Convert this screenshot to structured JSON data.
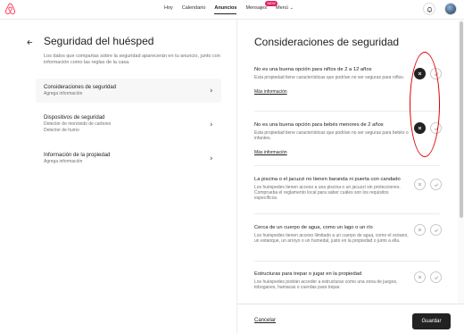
{
  "nav": {
    "links": [
      "Hoy",
      "Calendario",
      "Anuncios",
      "Mensajes",
      "Menú"
    ],
    "active": "Anuncios",
    "messages_badge": "NEW"
  },
  "left": {
    "title": "Seguridad del huésped",
    "description": "Los datos que compartas sobre la seguridad aparecerán en tu anuncio, junto con información como las reglas de la casa.",
    "items": [
      {
        "title": "Consideraciones de seguridad",
        "sub": [
          "Agrega información"
        ],
        "selected": true
      },
      {
        "title": "Dispositivos de seguridad",
        "sub": [
          "Detector de monóxido de carbono",
          "Detector de humo"
        ],
        "selected": false
      },
      {
        "title": "Información de la propiedad",
        "sub": [
          "Agrega información"
        ],
        "selected": false
      }
    ]
  },
  "right": {
    "title": "Consideraciones de seguridad",
    "items": [
      {
        "title": "No es una buena opción para niños de 2 a 12 años",
        "desc": "Esta propiedad tiene características que podrían no ser seguras para niños.",
        "link": "Más información",
        "state": "no"
      },
      {
        "title": "No es una buena opción para bebés menores de 2 años",
        "desc": "Esta propiedad tiene características que podrían no ser seguras para bebés o infantes.",
        "link": "Más información",
        "state": "no"
      },
      {
        "title": "La piscina o el jacuzzi no tienen baranda ni puerta con candado",
        "desc": "Los huéspedes tienen acceso a una piscina o un jacuzzi sin protecciones. Comprueba el reglamento local para saber cuáles son los requisitos específicos.",
        "link": "",
        "state": "none"
      },
      {
        "title": "Cerca de un cuerpo de agua, como un lago o un río",
        "desc": "Los huéspedes tienen acceso ilimitado a un cuerpo de agua, como el océano, un estanque, un arroyo o un humedal, justo en la propiedad o junto a ella.",
        "link": "",
        "state": "none"
      },
      {
        "title": "Estructuras para trepar o jugar en la propiedad",
        "desc": "Los huéspedes podrán acceder a estructuras como una zona de juegos, toboganes, hamacas o cuerdas para trepar.",
        "link": "",
        "state": "none"
      }
    ]
  },
  "footer": {
    "cancel": "Cancelar",
    "save": "Guardar"
  },
  "colors": {
    "brand": "#FF385C",
    "text": "#222222",
    "muted": "#717171",
    "annotation": "#E00000"
  },
  "icons": {
    "logo": "airbnb-logo",
    "bell": "bell-icon",
    "back": "arrow-left-icon",
    "chevron": "chevron-right-icon",
    "x": "x-icon",
    "check": "check-icon"
  }
}
